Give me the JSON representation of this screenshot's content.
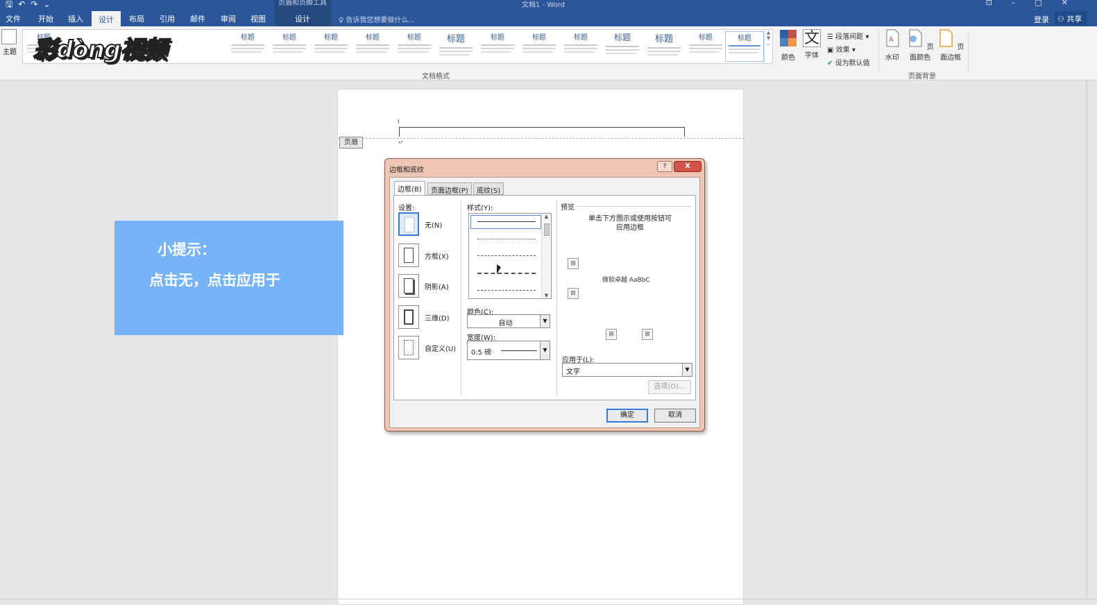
{
  "window": {
    "title": "文档1 - Word",
    "context_tools_label": "页眉和页脚工具"
  },
  "tabs": [
    "文件",
    "开始",
    "插入",
    "设计",
    "布局",
    "引用",
    "邮件",
    "审阅",
    "视图"
  ],
  "active_tab": "设计",
  "context_tab": "设计",
  "tell_me": "告诉我您想要做什么...",
  "account": {
    "signin": "登录",
    "share": "共享"
  },
  "ribbon": {
    "theme_label": "主题",
    "gallery_heading": "标题",
    "group_doc_format": "文档格式",
    "colors_label": "颜色",
    "fonts_label": "字体",
    "font_glyph": "文",
    "para_spacing": "段落间距",
    "effects": "效果",
    "set_default": "设为默认值",
    "watermark": "水印",
    "page_color": "页面颜色",
    "page_borders": "页面边框",
    "group_page_bg": "页面背景"
  },
  "document": {
    "header_tag": "页眉"
  },
  "hint": {
    "line1": "小提示：",
    "line2": "点击无，点击应用于"
  },
  "dialog": {
    "title": "边框和底纹",
    "help": "?",
    "close": "X",
    "tabs": [
      "边框(B)",
      "页面边框(P)",
      "底纹(S)"
    ],
    "settings_label": "设置:",
    "settings": [
      "无(N)",
      "方框(X)",
      "阴影(A)",
      "三维(D)",
      "自定义(U)"
    ],
    "style_label": "样式(Y):",
    "color_label": "颜色(C):",
    "color_value": "自动",
    "width_label": "宽度(W):",
    "width_value": "0.5 磅",
    "preview_label": "预览",
    "preview_tip_1": "单击下方图示或使用按钮可",
    "preview_tip_2": "应用边框",
    "preview_sample": "微软卓越  AaBbC",
    "apply_to_label": "应用于(L):",
    "apply_to_value": "文字",
    "options_button": "选项(O)...",
    "ok_button": "确定",
    "cancel_button": "取消"
  }
}
